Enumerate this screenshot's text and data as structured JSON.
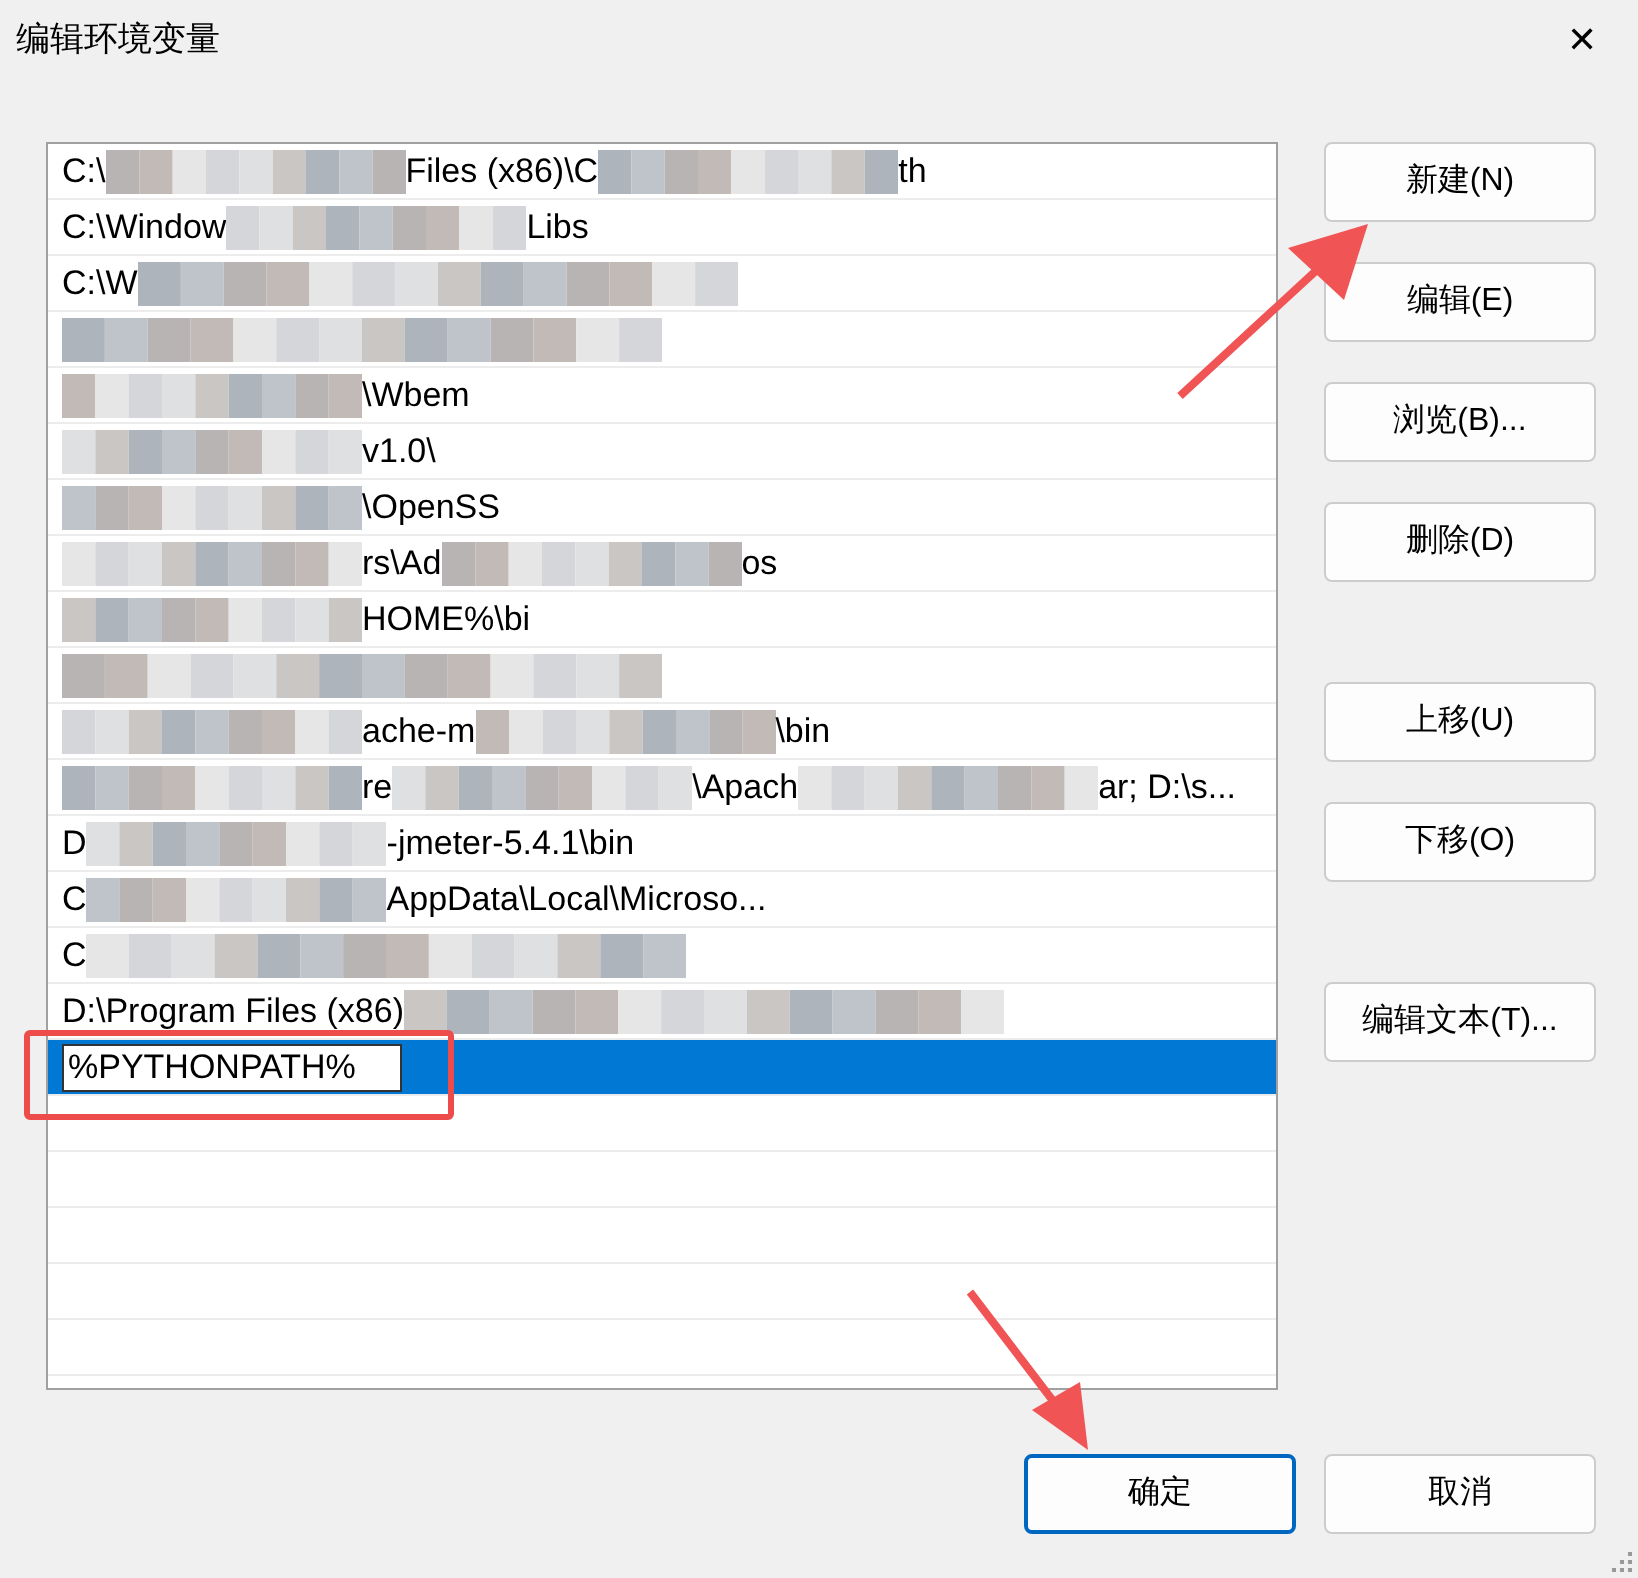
{
  "window": {
    "title": "编辑环境变量",
    "close": "✕"
  },
  "list": {
    "rows": [
      {
        "selected": false,
        "parts": [
          {
            "kind": "text",
            "text": "C:\\"
          },
          {
            "kind": "blur"
          },
          {
            "kind": "text",
            "text": "Files (x86)\\C"
          },
          {
            "kind": "blur"
          },
          {
            "kind": "text",
            "text": "th"
          }
        ]
      },
      {
        "selected": false,
        "parts": [
          {
            "kind": "text",
            "text": "C:\\Window"
          },
          {
            "kind": "blur"
          },
          {
            "kind": "text",
            "text": "Libs"
          }
        ]
      },
      {
        "selected": false,
        "parts": [
          {
            "kind": "text",
            "text": "C:\\W"
          },
          {
            "kind": "blur"
          }
        ]
      },
      {
        "selected": false,
        "parts": [
          {
            "kind": "blur"
          }
        ]
      },
      {
        "selected": false,
        "parts": [
          {
            "kind": "blur"
          },
          {
            "kind": "text",
            "text": "\\Wbem"
          }
        ]
      },
      {
        "selected": false,
        "parts": [
          {
            "kind": "blur"
          },
          {
            "kind": "text",
            "text": "v1.0\\"
          }
        ]
      },
      {
        "selected": false,
        "parts": [
          {
            "kind": "blur"
          },
          {
            "kind": "text",
            "text": "\\OpenSS"
          }
        ]
      },
      {
        "selected": false,
        "parts": [
          {
            "kind": "blur"
          },
          {
            "kind": "text",
            "text": "rs\\Ad"
          },
          {
            "kind": "blur"
          },
          {
            "kind": "text",
            "text": "os"
          }
        ]
      },
      {
        "selected": false,
        "parts": [
          {
            "kind": "blur"
          },
          {
            "kind": "text",
            "text": "HOME%\\bi"
          }
        ]
      },
      {
        "selected": false,
        "parts": [
          {
            "kind": "blur"
          }
        ]
      },
      {
        "selected": false,
        "parts": [
          {
            "kind": "blur"
          },
          {
            "kind": "text",
            "text": "ache-m"
          },
          {
            "kind": "blur"
          },
          {
            "kind": "text",
            "text": "\\bin"
          }
        ]
      },
      {
        "selected": false,
        "parts": [
          {
            "kind": "blur"
          },
          {
            "kind": "text",
            "text": "re"
          },
          {
            "kind": "blur"
          },
          {
            "kind": "text",
            "text": "\\Apach"
          },
          {
            "kind": "blur"
          },
          {
            "kind": "text",
            "text": "ar; D:\\s..."
          }
        ]
      },
      {
        "selected": false,
        "parts": [
          {
            "kind": "text",
            "text": "D"
          },
          {
            "kind": "blur"
          },
          {
            "kind": "text",
            "text": "-jmeter-5.4.1\\bin"
          }
        ]
      },
      {
        "selected": false,
        "parts": [
          {
            "kind": "text",
            "text": "C"
          },
          {
            "kind": "blur"
          },
          {
            "kind": "text",
            "text": "AppData\\Local\\Microso..."
          }
        ]
      },
      {
        "selected": false,
        "parts": [
          {
            "kind": "text",
            "text": "C"
          },
          {
            "kind": "blur"
          }
        ]
      },
      {
        "selected": false,
        "parts": [
          {
            "kind": "text",
            "text": "D:\\Program Files (x86)"
          },
          {
            "kind": "blur"
          }
        ]
      },
      {
        "selected": true,
        "parts": [
          {
            "kind": "edit",
            "text": "%PYTHONPATH%"
          }
        ]
      }
    ]
  },
  "side_button_groups": [
    [
      "新建(N)",
      "编辑(E)",
      "浏览(B)...",
      "删除(D)"
    ],
    [
      "上移(U)",
      "下移(O)"
    ],
    [
      "编辑文本(T)..."
    ]
  ],
  "footer_buttons": [
    {
      "label": "确定",
      "default": true
    },
    {
      "label": "取消",
      "default": false
    }
  ]
}
